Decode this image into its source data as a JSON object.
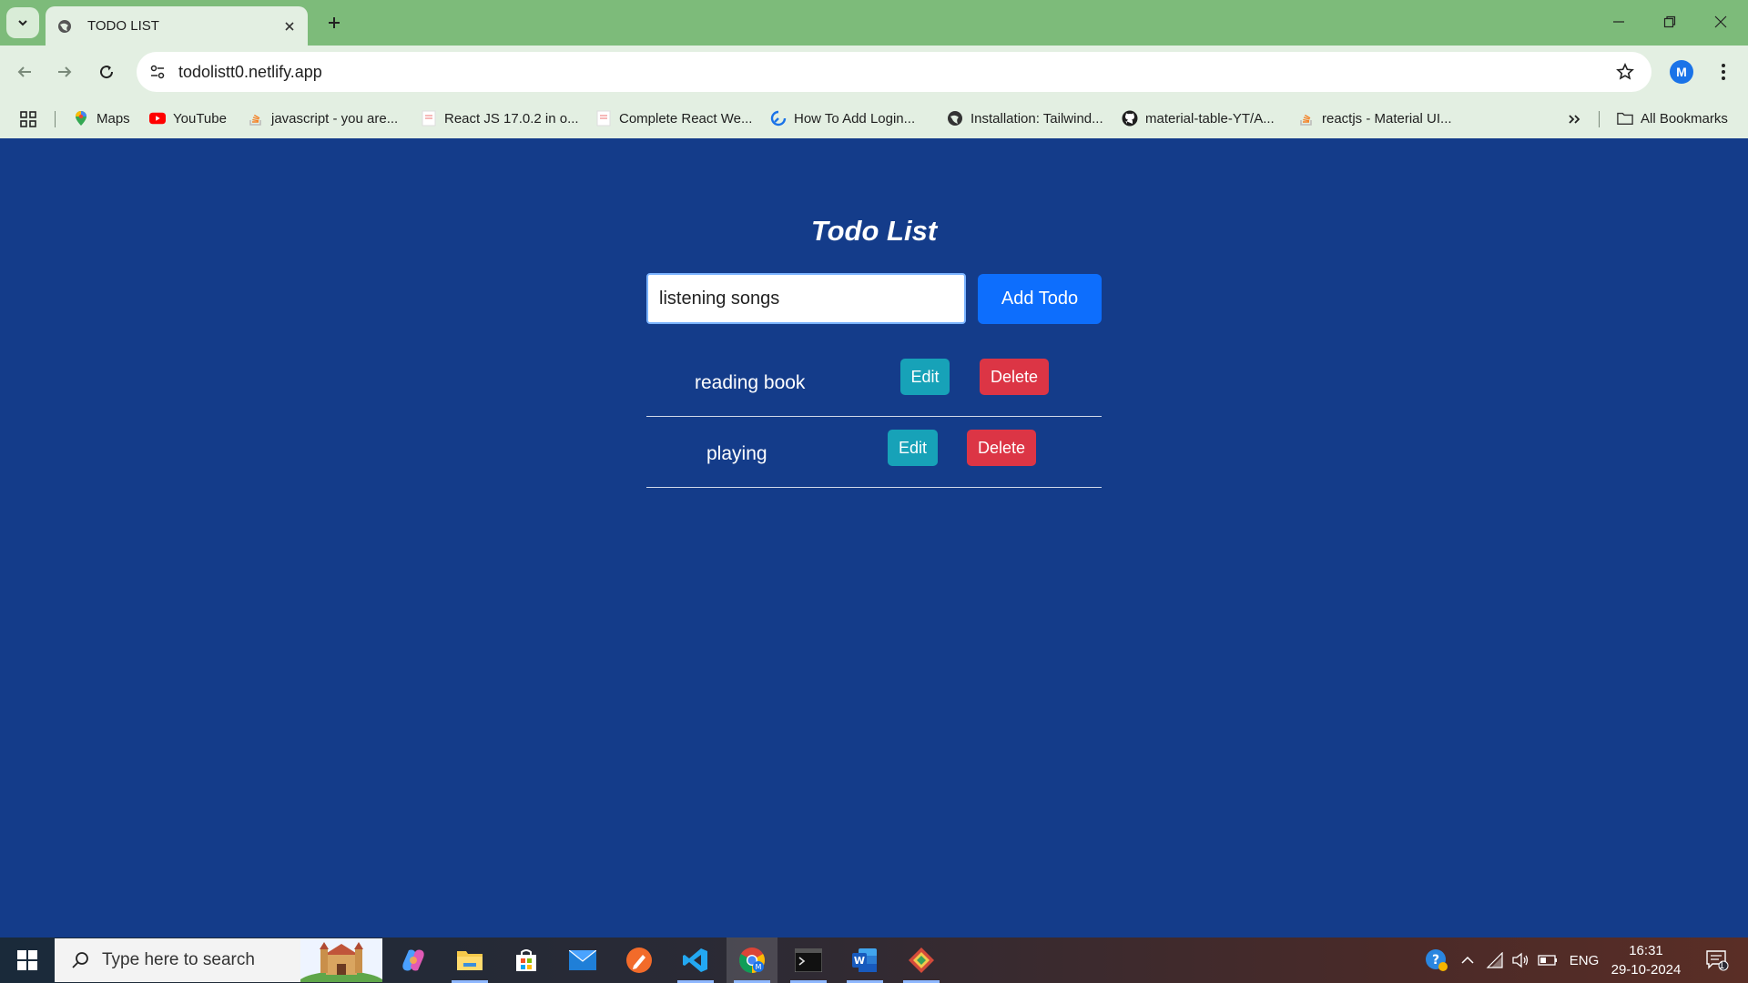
{
  "browser": {
    "tab_title": "TODO LIST",
    "url": "todolistt0.netlify.app",
    "profile_initial": "M",
    "bookmarks": [
      {
        "label": "Maps",
        "icon": "maps-icon"
      },
      {
        "label": "YouTube",
        "icon": "youtube-icon"
      },
      {
        "label": "javascript - you are...",
        "icon": "stackoverflow-icon"
      },
      {
        "label": "React JS 17.0.2 in o...",
        "icon": "page-icon"
      },
      {
        "label": "Complete React We...",
        "icon": "page-icon"
      },
      {
        "label": "How To Add Login...",
        "icon": "site-icon"
      },
      {
        "label": "Installation: Tailwind...",
        "icon": "globe-icon"
      },
      {
        "label": "material-table-YT/A...",
        "icon": "github-icon"
      },
      {
        "label": "reactjs - Material UI...",
        "icon": "stackoverflow-icon"
      }
    ],
    "all_bookmarks": "All Bookmarks"
  },
  "app": {
    "title": "Todo List",
    "input_value": "listening songs",
    "add_button": "Add Todo",
    "todos": [
      {
        "text": "reading book",
        "edit": "Edit",
        "delete": "Delete"
      },
      {
        "text": "playing",
        "edit": "Edit",
        "delete": "Delete"
      }
    ],
    "colors": {
      "background": "#143c8a",
      "primary": "#0d6efd",
      "edit": "#17a2b8",
      "delete": "#dc3545"
    }
  },
  "taskbar": {
    "search_placeholder": "Type here to search",
    "apps": [
      "copilot-icon",
      "file-explorer-icon",
      "store-icon",
      "mail-icon",
      "pen-app-icon",
      "vscode-icon",
      "chrome-icon",
      "terminal-icon",
      "word-icon",
      "git-icon"
    ],
    "language": "ENG",
    "time": "16:31",
    "date": "29-10-2024",
    "notification_count": "1"
  }
}
